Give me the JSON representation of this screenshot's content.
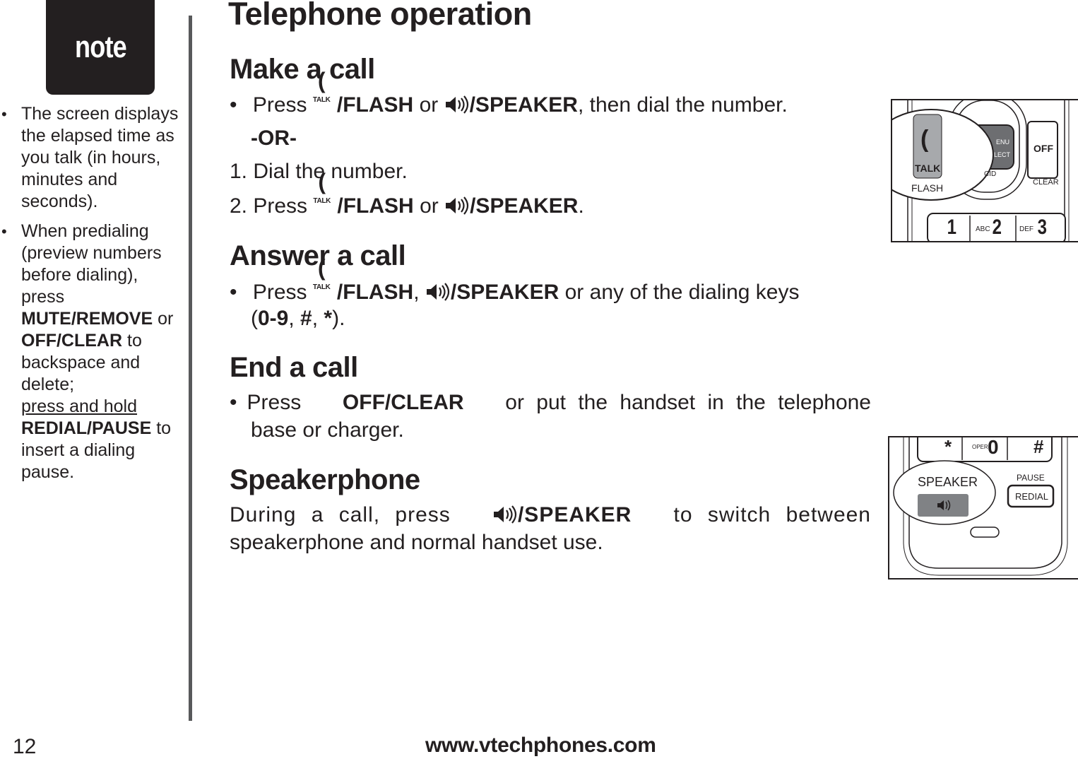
{
  "page": {
    "title": "Telephone operation",
    "page_number": "12",
    "footer_url": "www.vtechphones.com"
  },
  "note": {
    "badge": "note",
    "items": [
      {
        "text": "The screen displays the elapsed time as you talk (in hours, minutes and seconds)."
      },
      {
        "part1": "When predialing (preview numbers before dialing), press",
        "key1": "MUTE/REMOVE",
        "or": "or",
        "key2": "OFF/CLEAR",
        "part2": "to backspace and delete;",
        "underlined": "press and hold",
        "key3": "REDIAL/PAUSE",
        "part3": "to insert a dialing pause."
      }
    ]
  },
  "icons": {
    "talk_label": "TALK",
    "talk_hook": "(",
    "bullet": "•"
  },
  "sections": {
    "make_call": {
      "heading": "Make a call",
      "bullet_press": "Press",
      "flash": "/FLASH",
      "or": "or",
      "speaker": "/SPEAKER",
      "then": ", then dial the number.",
      "or_separator": "-OR-",
      "step1": "1. Dial the number.",
      "step2_prefix": "2. Press",
      "period": "."
    },
    "answer_call": {
      "heading": "Answer a call",
      "press": "Press",
      "flash": "/FLASH",
      "comma": ",",
      "speaker": "/SPEAKER",
      "rest": "or any of the dialing keys",
      "keys_open": "(",
      "keys_range": "0-9",
      "sep": ", ",
      "hash": "#",
      "star": "*",
      "keys_close": ")."
    },
    "end_call": {
      "heading": "End a call",
      "press": "Press",
      "key": "OFF/CLEAR",
      "rest": "or put the handset in the telephone",
      "line2": "base or charger."
    },
    "speakerphone": {
      "heading": "Speakerphone",
      "prefix": "During a call, press",
      "speaker": "/SPEAKER",
      "rest": "to switch between",
      "line2": "speakerphone and normal handset use."
    }
  },
  "illustration_top": {
    "talk": "TALK",
    "flash": "FLASH",
    "menu": "ENU",
    "select": "LECT",
    "cid": "CID",
    "off": "OFF",
    "clear": "CLEAR",
    "keys": [
      {
        "letters": "",
        "digit": "1"
      },
      {
        "letters": "ABC",
        "digit": "2"
      },
      {
        "letters": "DEF",
        "digit": "3"
      }
    ]
  },
  "illustration_bottom": {
    "star": "*",
    "oper": "OPER",
    "zero": "0",
    "hash": "#",
    "speaker": "SPEAKER",
    "pause": "PAUSE",
    "redial": "REDIAL"
  }
}
